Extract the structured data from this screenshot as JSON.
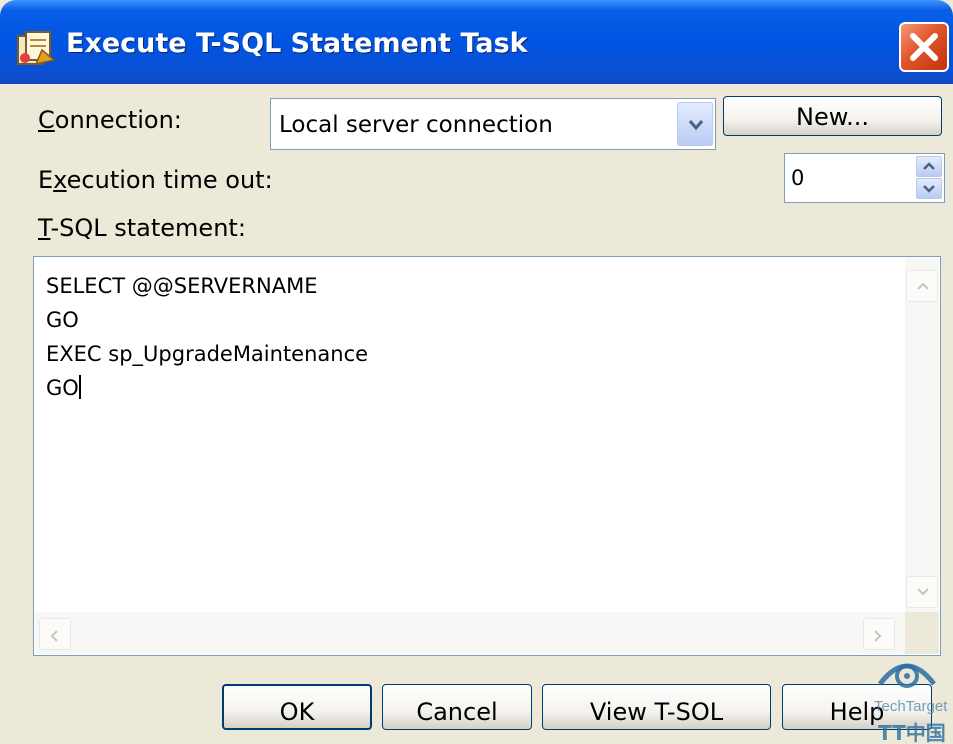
{
  "window": {
    "title": "Execute T-SQL Statement Task"
  },
  "connection": {
    "label_mnemonic": "C",
    "label_rest": "onnection:",
    "value": "Local server connection",
    "new_button": "New..."
  },
  "timeout": {
    "label_pre": "E",
    "label_mnemonic": "x",
    "label_rest": "ecution time out:",
    "value": "0"
  },
  "statement": {
    "label_mnemonic": "T",
    "label_rest": "-SQL statement:",
    "lines": [
      "SELECT @@SERVERNAME",
      "GO",
      "EXEC sp_UpgradeMaintenance",
      "GO"
    ]
  },
  "buttons": {
    "ok": "OK",
    "cancel": "Cancel",
    "view_tsql": "View T-SOL",
    "help": "Help"
  },
  "watermark": {
    "text_top": "TechTarget",
    "text_bottom": "TT中国"
  },
  "icons": {
    "title": "task-icon",
    "close": "close-icon",
    "combo": "chevron-down-icon",
    "spin_up": "chevron-up-icon",
    "spin_down": "chevron-down-icon",
    "watermark": "techtarget-logo"
  },
  "colors": {
    "titlebar": "#0054e3",
    "dialog": "#ece9d8",
    "close": "#e2542a",
    "border": "#7f9db9"
  }
}
